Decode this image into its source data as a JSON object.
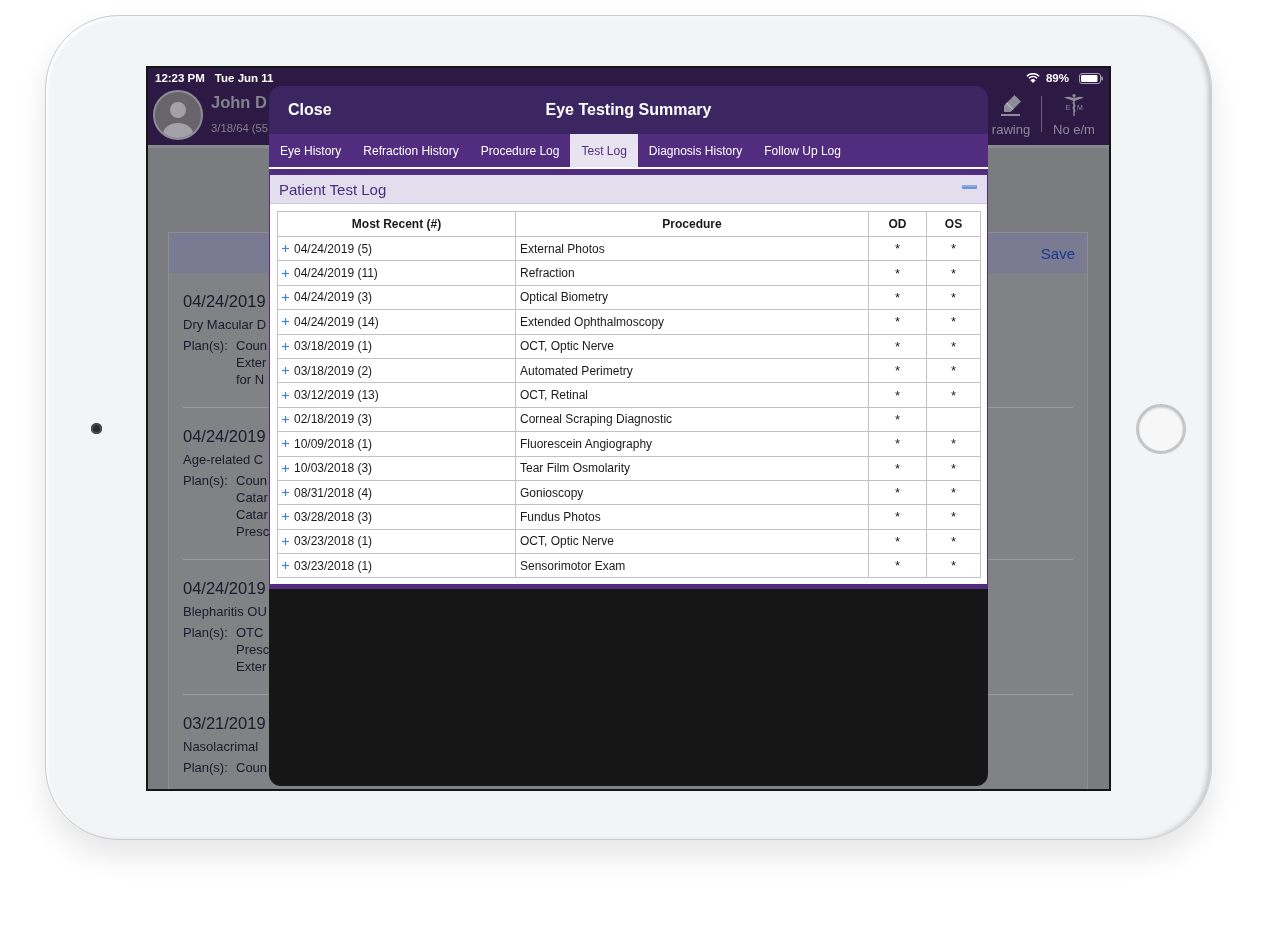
{
  "status_bar": {
    "time": "12:23 PM",
    "date": "Tue Jun 11",
    "battery": "89%"
  },
  "patient_header": {
    "name": "John D",
    "dob": "3/18/64 (55",
    "tools": [
      {
        "kind": "drawing",
        "label": "rawing"
      },
      {
        "kind": "em",
        "label": "No e/m",
        "icon_letters": [
          "E",
          "M"
        ]
      }
    ]
  },
  "background_card": {
    "save": "Save",
    "entries": [
      {
        "date": "04/24/2019",
        "diagnosis": "Dry Macular D",
        "plan_label": "Plan(s):",
        "plans": [
          "Coun",
          "Exter",
          "for N"
        ]
      },
      {
        "date": "04/24/2019",
        "diagnosis": "Age-related C",
        "plan_label": "Plan(s):",
        "plans": [
          "Coun",
          "Catar",
          "Catar",
          "Presc"
        ]
      },
      {
        "date": "04/24/2019",
        "diagnosis": "Blepharitis OU",
        "plan_label": "Plan(s):",
        "plans": [
          "OTC",
          "Presc",
          "Exter"
        ]
      },
      {
        "date": "03/21/2019",
        "diagnosis": "Nasolacrimal",
        "plan_label": "Plan(s):",
        "plans": [
          "Coun"
        ]
      }
    ]
  },
  "modal": {
    "close": "Close",
    "title": "Eye Testing Summary",
    "tabs": [
      {
        "label": "Eye History",
        "selected": false
      },
      {
        "label": "Refraction History",
        "selected": false
      },
      {
        "label": "Procedure Log",
        "selected": false
      },
      {
        "label": "Test Log",
        "selected": true
      },
      {
        "label": "Diagnosis History",
        "selected": false
      },
      {
        "label": "Follow Up Log",
        "selected": false
      }
    ],
    "panel": {
      "title": "Patient Test Log",
      "collapsed": false,
      "table": {
        "columns": [
          "Most Recent (#)",
          "Procedure",
          "OD",
          "OS"
        ],
        "rows": [
          {
            "most_recent": "04/24/2019 (5)",
            "procedure": "External Photos",
            "od": "*",
            "os": "*",
            "expanded": false
          },
          {
            "most_recent": "04/24/2019 (11)",
            "procedure": "Refraction",
            "od": "*",
            "os": "*",
            "expanded": false
          },
          {
            "most_recent": "04/24/2019 (3)",
            "procedure": "Optical Biometry",
            "od": "*",
            "os": "*",
            "expanded": false
          },
          {
            "most_recent": "04/24/2019 (14)",
            "procedure": "Extended Ophthalmoscopy",
            "od": "*",
            "os": "*",
            "expanded": false
          },
          {
            "most_recent": "03/18/2019 (1)",
            "procedure": "OCT, Optic Nerve",
            "od": "*",
            "os": "*",
            "expanded": false
          },
          {
            "most_recent": "03/18/2019 (2)",
            "procedure": "Automated Perimetry",
            "od": "*",
            "os": "*",
            "expanded": false
          },
          {
            "most_recent": "03/12/2019 (13)",
            "procedure": "OCT, Retinal",
            "od": "*",
            "os": "*",
            "expanded": false
          },
          {
            "most_recent": "02/18/2019 (3)",
            "procedure": "Corneal Scraping Diagnostic",
            "od": "*",
            "expanded": false
          },
          {
            "most_recent": "10/09/2018 (1)",
            "procedure": "Fluorescein Angiography",
            "od": "*",
            "os": "*",
            "expanded": false
          },
          {
            "most_recent": "10/03/2018 (3)",
            "procedure": "Tear Film Osmolarity",
            "od": "*",
            "os": "*",
            "expanded": false
          },
          {
            "most_recent": "08/31/2018 (4)",
            "procedure": "Gonioscopy",
            "od": "*",
            "os": "*",
            "expanded": false
          },
          {
            "most_recent": "03/28/2018 (3)",
            "procedure": "Fundus Photos",
            "od": "*",
            "os": "*",
            "expanded": false
          },
          {
            "most_recent": "03/23/2018 (1)",
            "procedure": "OCT, Optic Nerve",
            "od": "*",
            "os": "*",
            "expanded": false
          },
          {
            "most_recent": "03/23/2018 (1)",
            "procedure": "Sensorimotor Exam",
            "od": "*",
            "os": "*",
            "expanded": false
          }
        ]
      }
    }
  }
}
